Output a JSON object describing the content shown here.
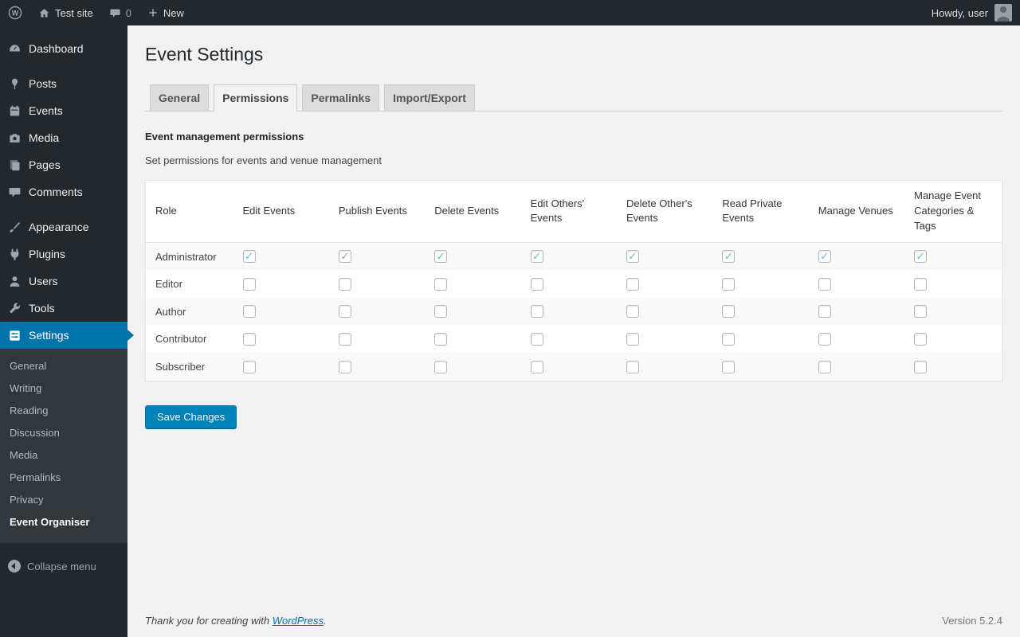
{
  "admin_bar": {
    "site_name": "Test site",
    "comments_count": "0",
    "new_label": "New",
    "howdy": "Howdy, user"
  },
  "sidebar": {
    "items": [
      {
        "label": "Dashboard",
        "icon": "dashboard-icon",
        "separator_after": true
      },
      {
        "label": "Posts",
        "icon": "posts-icon"
      },
      {
        "label": "Events",
        "icon": "events-icon"
      },
      {
        "label": "Media",
        "icon": "media-icon"
      },
      {
        "label": "Pages",
        "icon": "pages-icon"
      },
      {
        "label": "Comments",
        "icon": "comments-icon",
        "separator_after": true
      },
      {
        "label": "Appearance",
        "icon": "appearance-icon"
      },
      {
        "label": "Plugins",
        "icon": "plugins-icon"
      },
      {
        "label": "Users",
        "icon": "users-icon"
      },
      {
        "label": "Tools",
        "icon": "tools-icon"
      },
      {
        "label": "Settings",
        "icon": "settings-icon",
        "active": true
      }
    ],
    "settings_submenu": [
      "General",
      "Writing",
      "Reading",
      "Discussion",
      "Media",
      "Permalinks",
      "Privacy",
      "Event Organiser"
    ],
    "current_submenu": "Event Organiser",
    "collapse_label": "Collapse menu"
  },
  "page": {
    "title": "Event Settings",
    "tabs": [
      {
        "label": "General",
        "active": false
      },
      {
        "label": "Permissions",
        "active": true
      },
      {
        "label": "Permalinks",
        "active": false
      },
      {
        "label": "Import/Export",
        "active": false
      }
    ],
    "section_heading": "Event management permissions",
    "section_description": "Set permissions for events and venue management",
    "permissions_table": {
      "columns": [
        "Role",
        "Edit Events",
        "Publish Events",
        "Delete Events",
        "Edit Others' Events",
        "Delete Other's Events",
        "Read Private Events",
        "Manage Venues",
        "Manage Event Categories & Tags"
      ],
      "rows": [
        {
          "role": "Administrator",
          "checks": [
            true,
            true,
            true,
            true,
            true,
            true,
            true,
            true
          ]
        },
        {
          "role": "Editor",
          "checks": [
            false,
            false,
            false,
            false,
            false,
            false,
            false,
            false
          ]
        },
        {
          "role": "Author",
          "checks": [
            false,
            false,
            false,
            false,
            false,
            false,
            false,
            false
          ]
        },
        {
          "role": "Contributor",
          "checks": [
            false,
            false,
            false,
            false,
            false,
            false,
            false,
            false
          ]
        },
        {
          "role": "Subscriber",
          "checks": [
            false,
            false,
            false,
            false,
            false,
            false,
            false,
            false
          ]
        }
      ]
    },
    "save_button": "Save Changes"
  },
  "footer": {
    "thanks_prefix": "Thank you for creating with ",
    "thanks_link": "WordPress",
    "thanks_suffix": ".",
    "version": "Version 5.2.4"
  },
  "colors": {
    "accent": "#0073aa",
    "admin_bar_background": "#23282d",
    "sidebar_background": "#23282d",
    "submenu_background": "#32373c",
    "button_primary": "#0085ba",
    "page_background": "#f1f1f1",
    "checked_checkbox": "#1e8cbe"
  }
}
